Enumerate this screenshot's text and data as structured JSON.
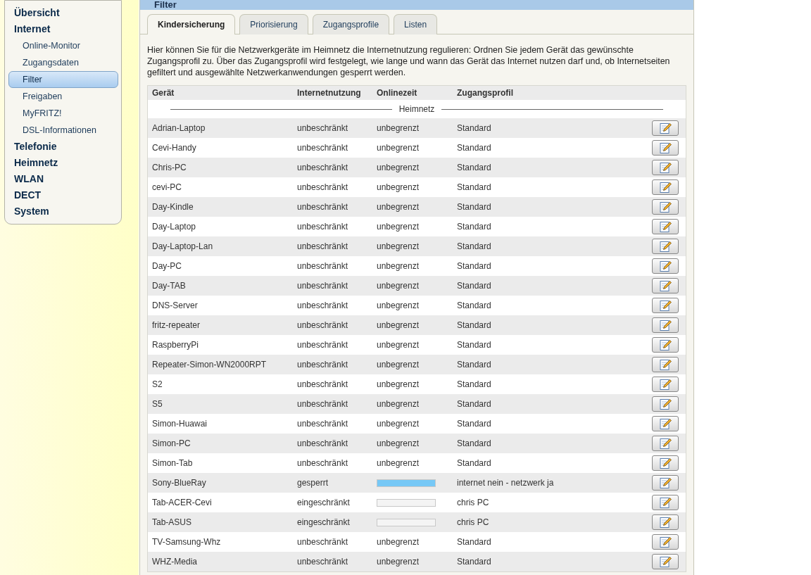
{
  "sidebar": {
    "items": [
      {
        "label": "Übersicht",
        "kind": "section",
        "selected": false
      },
      {
        "label": "Internet",
        "kind": "section",
        "selected": false
      },
      {
        "label": "Online-Monitor",
        "kind": "sub",
        "selected": false
      },
      {
        "label": "Zugangsdaten",
        "kind": "sub",
        "selected": false
      },
      {
        "label": "Filter",
        "kind": "sub",
        "selected": true
      },
      {
        "label": "Freigaben",
        "kind": "sub",
        "selected": false
      },
      {
        "label": "MyFRITZ!",
        "kind": "sub",
        "selected": false
      },
      {
        "label": "DSL-Informationen",
        "kind": "sub",
        "selected": false
      },
      {
        "label": "Telefonie",
        "kind": "section",
        "selected": false
      },
      {
        "label": "Heimnetz",
        "kind": "section",
        "selected": false
      },
      {
        "label": "WLAN",
        "kind": "section",
        "selected": false
      },
      {
        "label": "DECT",
        "kind": "section",
        "selected": false
      },
      {
        "label": "System",
        "kind": "section",
        "selected": false
      }
    ]
  },
  "panel": {
    "title": "Filter",
    "tabs": [
      {
        "label": "Kindersicherung",
        "selected": true
      },
      {
        "label": "Priorisierung",
        "selected": false
      },
      {
        "label": "Zugangsprofile",
        "selected": false
      },
      {
        "label": "Listen",
        "selected": false
      }
    ],
    "intro": "Hier können Sie für die Netzwerkgeräte im Heimnetz die Internetnutzung regulieren: Ordnen Sie jedem Gerät das gewünschte Zugangsprofil zu. Über das Zugangsprofil wird festgelegt, wie lange und wann das Gerät das Internet nutzen darf und, ob Internetseiten gefiltert und ausgewählte Netzwerkanwendungen gesperrt werden.",
    "table": {
      "columns": [
        "Gerät",
        "Internetnutzung",
        "Onlinezeit",
        "Zugangsprofil"
      ],
      "group": "Heimnetz",
      "rows": [
        {
          "device": "Adrian-Laptop",
          "usage": "unbeschränkt",
          "online": "unbegrenzt",
          "profile": "Standard"
        },
        {
          "device": "Cevi-Handy",
          "usage": "unbeschränkt",
          "online": "unbegrenzt",
          "profile": "Standard"
        },
        {
          "device": "Chris-PC",
          "usage": "unbeschränkt",
          "online": "unbegrenzt",
          "profile": "Standard"
        },
        {
          "device": "cevi-PC",
          "usage": "unbeschränkt",
          "online": "unbegrenzt",
          "profile": "Standard"
        },
        {
          "device": "Day-Kindle",
          "usage": "unbeschränkt",
          "online": "unbegrenzt",
          "profile": "Standard"
        },
        {
          "device": "Day-Laptop",
          "usage": "unbeschränkt",
          "online": "unbegrenzt",
          "profile": "Standard"
        },
        {
          "device": "Day-Laptop-Lan",
          "usage": "unbeschränkt",
          "online": "unbegrenzt",
          "profile": "Standard"
        },
        {
          "device": "Day-PC",
          "usage": "unbeschränkt",
          "online": "unbegrenzt",
          "profile": "Standard"
        },
        {
          "device": "Day-TAB",
          "usage": "unbeschränkt",
          "online": "unbegrenzt",
          "profile": "Standard"
        },
        {
          "device": "DNS-Server",
          "usage": "unbeschränkt",
          "online": "unbegrenzt",
          "profile": "Standard"
        },
        {
          "device": "fritz-repeater",
          "usage": "unbeschränkt",
          "online": "unbegrenzt",
          "profile": "Standard"
        },
        {
          "device": "RaspberryPi",
          "usage": "unbeschränkt",
          "online": "unbegrenzt",
          "profile": "Standard"
        },
        {
          "device": "Repeater-Simon-WN2000RPT",
          "usage": "unbeschränkt",
          "online": "unbegrenzt",
          "profile": "Standard"
        },
        {
          "device": "S2",
          "usage": "unbeschränkt",
          "online": "unbegrenzt",
          "profile": "Standard"
        },
        {
          "device": "S5",
          "usage": "unbeschränkt",
          "online": "unbegrenzt",
          "profile": "Standard"
        },
        {
          "device": "Simon-Huawai",
          "usage": "unbeschränkt",
          "online": "unbegrenzt",
          "profile": "Standard"
        },
        {
          "device": "Simon-PC",
          "usage": "unbeschränkt",
          "online": "unbegrenzt",
          "profile": "Standard"
        },
        {
          "device": "Simon-Tab",
          "usage": "unbeschränkt",
          "online": "unbegrenzt",
          "profile": "Standard"
        },
        {
          "device": "Sony-BlueRay",
          "usage": "gesperrt",
          "level": 1,
          "profile": "internet nein - netzwerk ja"
        },
        {
          "device": "Tab-ACER-Cevi",
          "usage": "eingeschränkt",
          "level": 0,
          "profile": "chris PC"
        },
        {
          "device": "Tab-ASUS",
          "usage": "eingeschränkt",
          "level": 0,
          "profile": "chris PC"
        },
        {
          "device": "TV-Samsung-Whz",
          "usage": "unbeschränkt",
          "online": "unbegrenzt",
          "profile": "Standard"
        },
        {
          "device": "WHZ-Media",
          "usage": "unbeschränkt",
          "online": "unbegrenzt",
          "profile": "Standard"
        }
      ]
    }
  }
}
